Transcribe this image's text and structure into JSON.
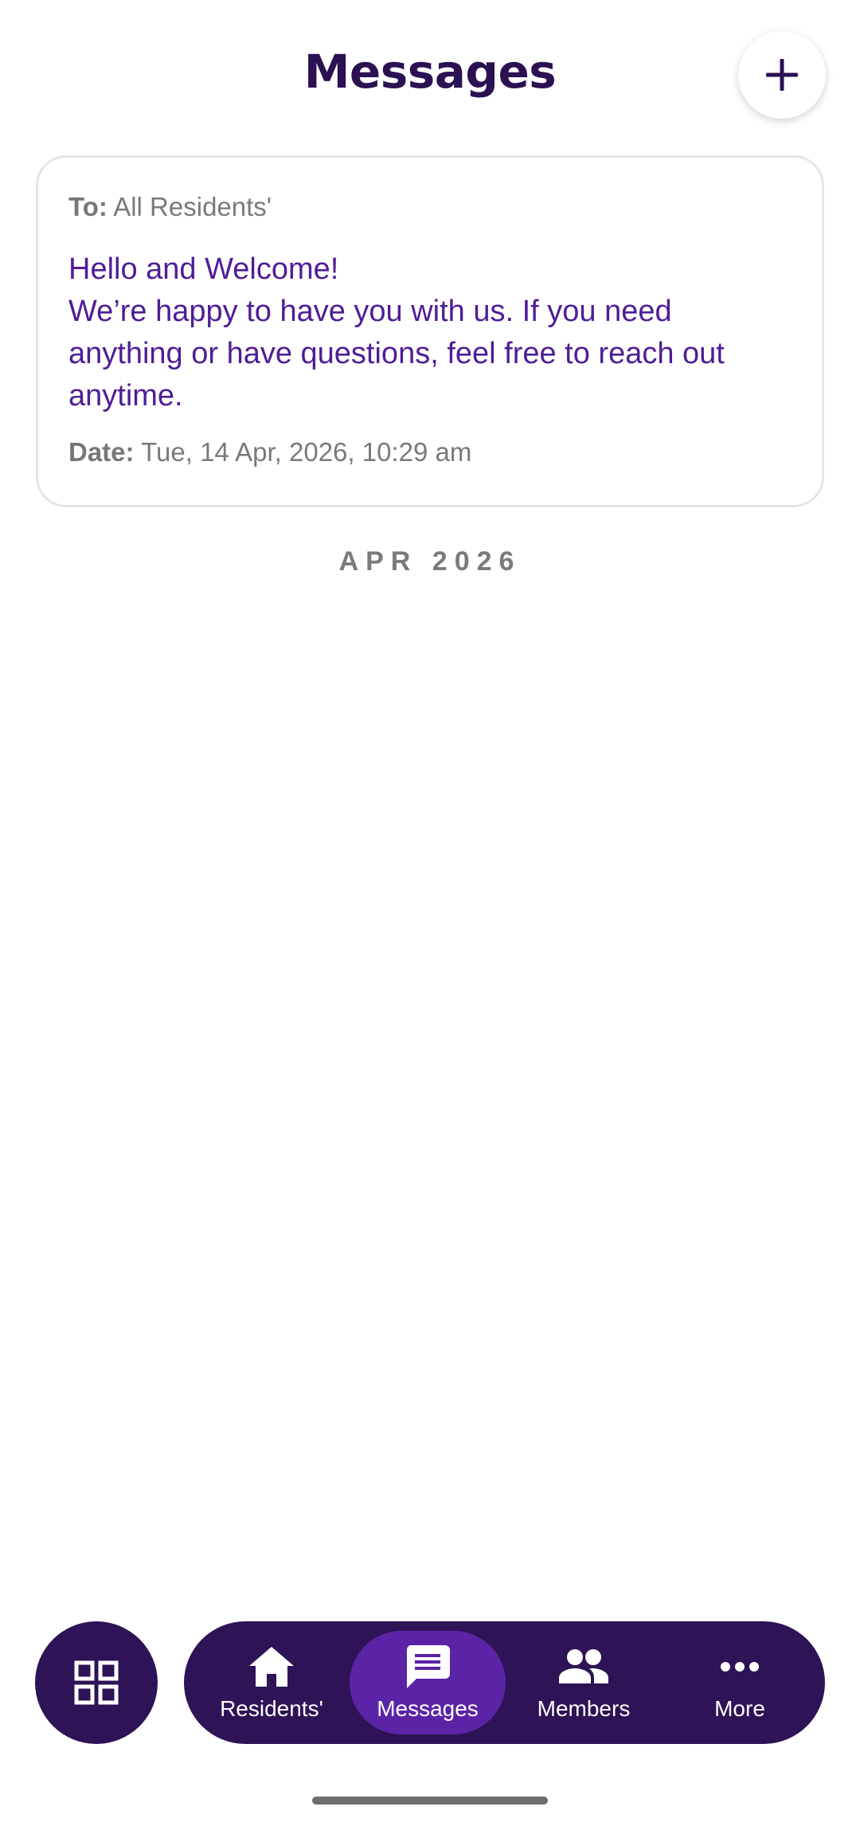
{
  "header": {
    "title": "Messages",
    "add_icon": "plus-icon"
  },
  "message": {
    "to_label": "To:",
    "to_value": " All Residents'",
    "title": "Hello and Welcome!",
    "text": "We’re happy to have you with us. If you need anything or have questions, feel free to reach out anytime.",
    "date_label": "Date:",
    "date_value": " Tue, 14 Apr, 2026, 10:29 am"
  },
  "month_separator": "APR 2026",
  "bottom_nav": {
    "grid_icon": "grid-icon",
    "active": "Messages",
    "items": [
      {
        "label": "Residents'",
        "icon": "home-icon"
      },
      {
        "label": "Messages",
        "icon": "message-icon"
      },
      {
        "label": "Members",
        "icon": "people-icon"
      },
      {
        "label": "More",
        "icon": "more-dots-icon"
      }
    ]
  },
  "colors": {
    "primary_dark": "#2e1356",
    "active_tab": "#5b24a6",
    "message_text": "#4f1d96",
    "muted_text": "#7a7a7a"
  }
}
